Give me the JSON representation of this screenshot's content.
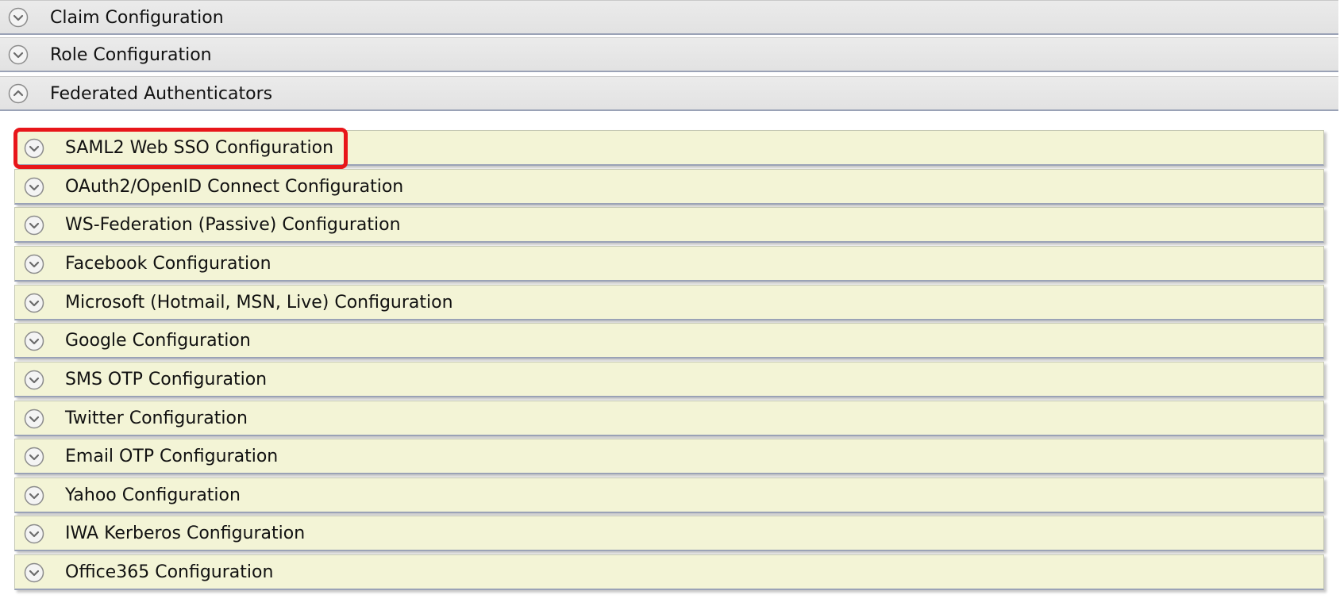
{
  "sections": {
    "claim_config": "Claim Configuration",
    "role_config": "Role Configuration",
    "federated_auth": "Federated Authenticators"
  },
  "authenticators": [
    "SAML2 Web SSO Configuration",
    "OAuth2/OpenID Connect Configuration",
    "WS-Federation (Passive) Configuration",
    "Facebook Configuration",
    "Microsoft (Hotmail, MSN, Live) Configuration",
    "Google Configuration",
    "SMS OTP Configuration",
    "Twitter Configuration",
    "Email OTP Configuration",
    "Yahoo Configuration",
    "IWA Kerberos Configuration",
    "Office365 Configuration"
  ],
  "highlight_color": "#e8161a",
  "icons": {
    "collapsed": "chevron-down-circle-icon",
    "expanded": "chevron-up-circle-icon"
  }
}
